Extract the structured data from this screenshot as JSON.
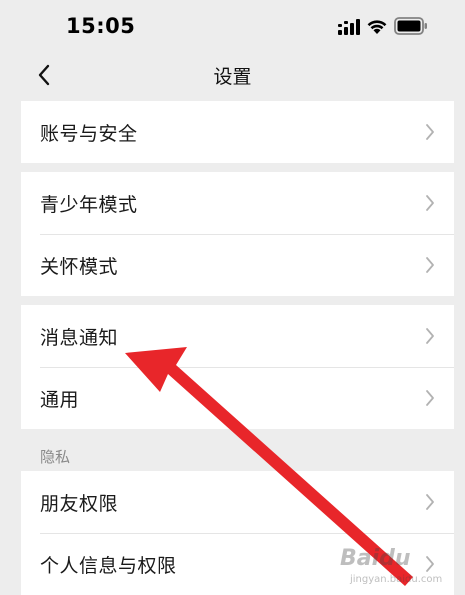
{
  "status_bar": {
    "time": "15:05",
    "icons": [
      "signal-icon",
      "wifi-icon",
      "battery-icon"
    ]
  },
  "nav": {
    "title": "设置",
    "back_icon": "chevron-left-icon"
  },
  "groups": [
    {
      "items": [
        {
          "label": "账号与安全"
        }
      ]
    },
    {
      "items": [
        {
          "label": "青少年模式"
        },
        {
          "label": "关怀模式"
        }
      ]
    },
    {
      "items": [
        {
          "label": "消息通知"
        },
        {
          "label": "通用"
        }
      ]
    },
    {
      "header": "隐私",
      "items": [
        {
          "label": "朋友权限"
        },
        {
          "label": "个人信息与权限"
        }
      ]
    }
  ],
  "annotation": {
    "type": "arrow",
    "color": "#e8262a",
    "points_to": "消息通知"
  },
  "watermark": {
    "text": "Baidu",
    "subtext": "jingyan.baidu.com"
  },
  "colors": {
    "background": "#ededed",
    "card": "#ffffff",
    "text": "#1a1a1a",
    "secondary_text": "#8a8a8a",
    "chevron": "#b2b2b2"
  }
}
